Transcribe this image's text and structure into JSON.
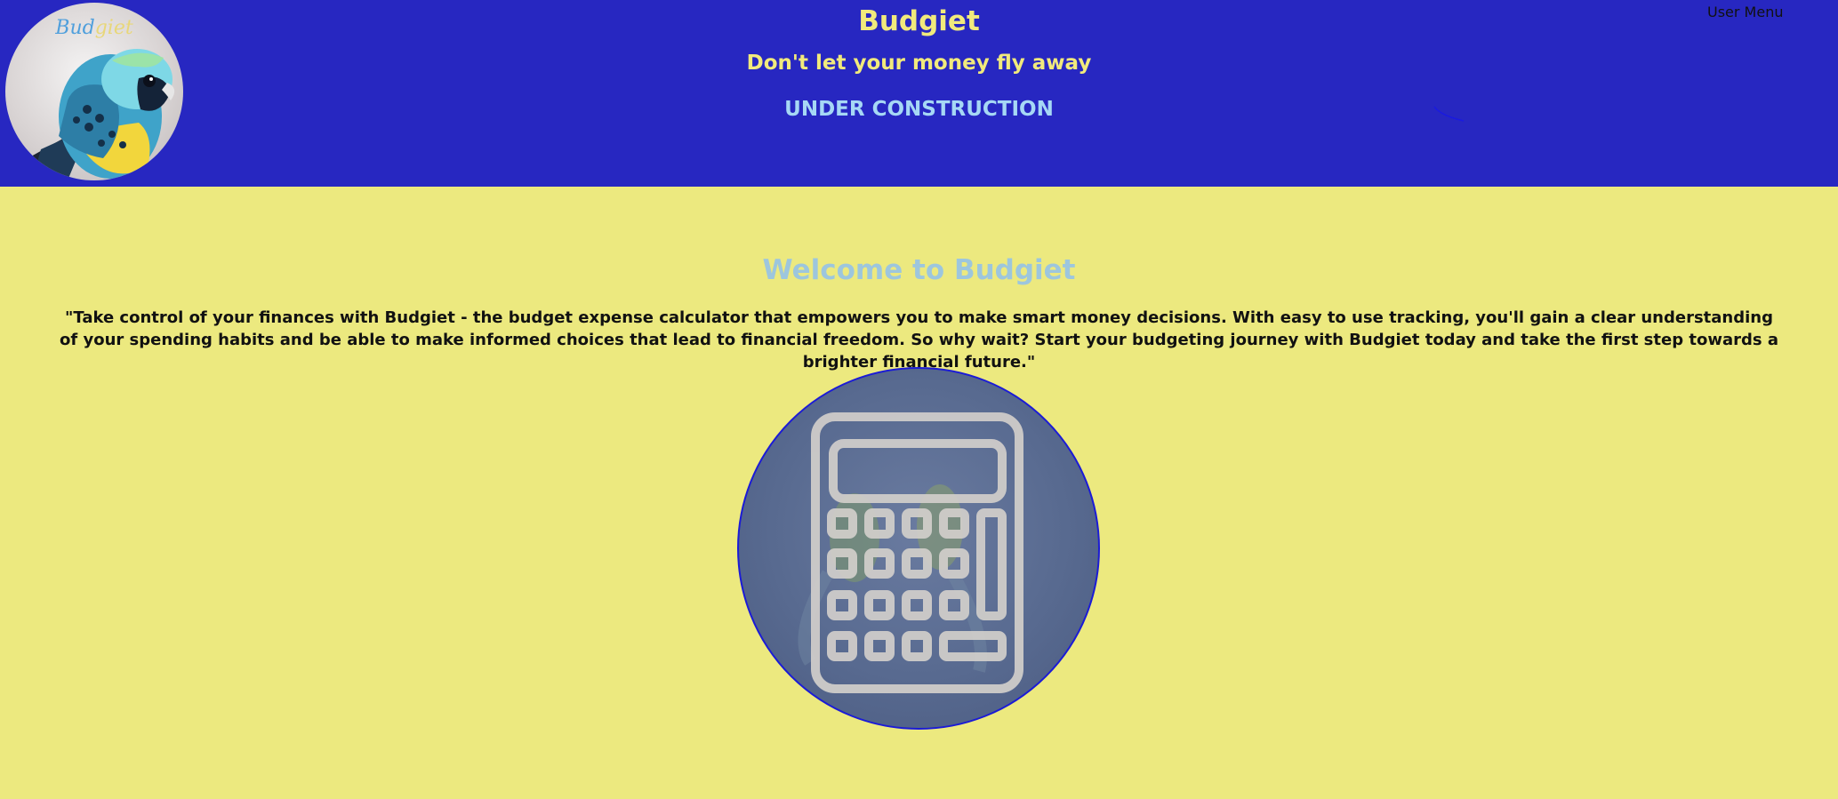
{
  "header": {
    "logo_text_part1": "Bud",
    "logo_text_part2": "giet",
    "title": "Budgiet",
    "tagline": "Don't let your money fly away",
    "status": "UNDER CONSTRUCTION",
    "user_menu": "User Menu"
  },
  "main": {
    "heading": "Welcome to Budgiet",
    "intro": "\"Take control of your finances with Budgiet - the budget expense calculator that empowers you to make smart money decisions. With easy to use tracking, you'll gain a clear understanding of your spending habits and be able to make informed choices that lead to financial freedom. So why wait? Start your budgeting journey with Budgiet today and take the first step towards a brighter financial future.\"",
    "hero_icon": "calculator-icon"
  },
  "colors": {
    "header_bg": "#2727c1",
    "page_bg": "#ece97f",
    "title_yellow": "#f1ea7c",
    "status_blue": "#a6d8f5",
    "welcome_blue": "#9dc6dd"
  }
}
